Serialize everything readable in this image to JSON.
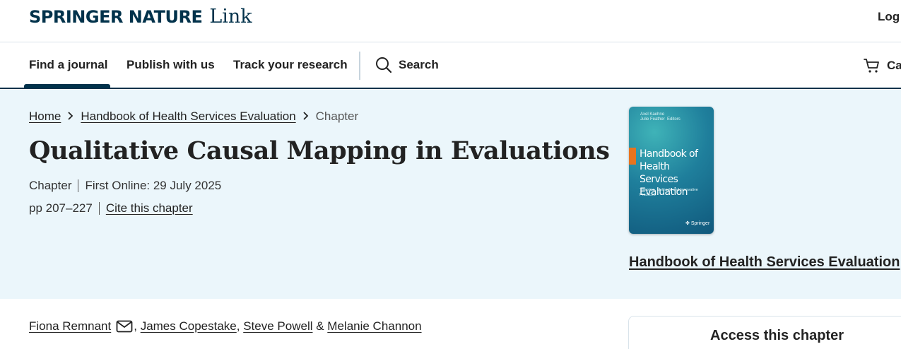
{
  "header": {
    "brand_primary": "SPRINGER NATURE",
    "brand_secondary": "Link",
    "login_label": "Log"
  },
  "nav": {
    "items": [
      {
        "label": "Find a journal",
        "active": true
      },
      {
        "label": "Publish with us",
        "active": false
      },
      {
        "label": "Track your research",
        "active": false
      }
    ],
    "search_label": "Search",
    "cart_label": "Ca"
  },
  "breadcrumb": {
    "home": "Home",
    "book": "Handbook of Health Services Evaluation",
    "current": "Chapter"
  },
  "chapter": {
    "title": "Qualitative Causal Mapping in Evaluations",
    "type": "Chapter",
    "first_online": "First Online: 29 July 2025",
    "pages": "pp 207–227",
    "cite_label": "Cite this chapter"
  },
  "book": {
    "link_label": "Handbook of Health Services Evaluation",
    "cover": {
      "editors": [
        "Axel Kaehne",
        "Julie Feather",
        "Editors"
      ],
      "title": "Handbook of Health Services Evaluation",
      "subtitle": "Theories, Methods and Innovative Practices",
      "publisher": "Springer"
    }
  },
  "authors": {
    "list": [
      "Fiona Remnant",
      "James Copestake",
      "Steve Powell",
      "Melanie Channon"
    ]
  },
  "access": {
    "title": "Access this chapter"
  },
  "colors": {
    "brand_navy": "#01324b",
    "hero_background": "#ebf6fb",
    "cover_accent": "#e8741e"
  }
}
